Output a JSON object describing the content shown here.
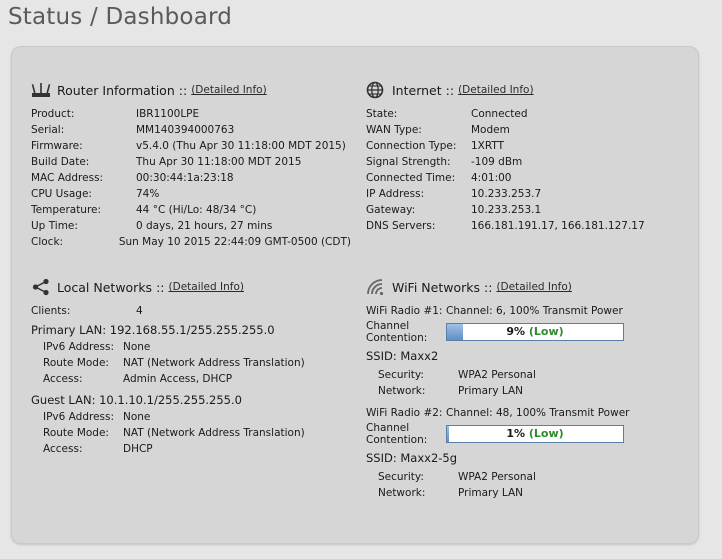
{
  "page": {
    "title": "Status / Dashboard"
  },
  "router": {
    "title": "Router Information",
    "sep": "::",
    "link": "(Detailed Info)",
    "rows": [
      {
        "k": "Product:",
        "v": "IBR1100LPE"
      },
      {
        "k": "Serial:",
        "v": "MM140394000763"
      },
      {
        "k": "Firmware:",
        "v": "v5.4.0 (Thu Apr 30 11:18:00 MDT 2015)"
      },
      {
        "k": "Build Date:",
        "v": "Thu Apr 30 11:18:00 MDT 2015"
      },
      {
        "k": "MAC Address:",
        "v": "00:30:44:1a:23:18"
      },
      {
        "k": "CPU Usage:",
        "v": "74%"
      },
      {
        "k": "Temperature:",
        "v": "44 °C (Hi/Lo: 48/34 °C)"
      },
      {
        "k": "Up Time:",
        "v": "0 days, 21 hours, 27 mins"
      },
      {
        "k": "Clock:",
        "v": "Sun May 10 2015 22:44:09 GMT-0500 (CDT)"
      }
    ]
  },
  "internet": {
    "title": "Internet",
    "sep": "::",
    "link": "(Detailed Info)",
    "rows": [
      {
        "k": "State:",
        "v": "Connected"
      },
      {
        "k": "WAN Type:",
        "v": "Modem"
      },
      {
        "k": "Connection Type:",
        "v": "1XRTT"
      },
      {
        "k": "Signal Strength:",
        "v": "-109 dBm"
      },
      {
        "k": "Connected Time:",
        "v": "4:01:00"
      },
      {
        "k": "IP Address:",
        "v": "10.233.253.7"
      },
      {
        "k": "Gateway:",
        "v": "10.233.253.1"
      },
      {
        "k": "DNS Servers:",
        "v": "166.181.191.17, 166.181.127.17"
      }
    ]
  },
  "local": {
    "title": "Local Networks",
    "sep": "::",
    "link": "(Detailed Info)",
    "clients_label": "Clients:",
    "clients_value": "4",
    "primary_lan": "Primary LAN: 192.168.55.1/255.255.255.0",
    "primary_rows": [
      {
        "k": "IPv6 Address:",
        "v": "None"
      },
      {
        "k": "Route Mode:",
        "v": "NAT (Network Address Translation)"
      },
      {
        "k": "Access:",
        "v": "Admin Access, DHCP"
      }
    ],
    "guest_lan": "Guest LAN: 10.1.10.1/255.255.255.0",
    "guest_rows": [
      {
        "k": "IPv6 Address:",
        "v": "None"
      },
      {
        "k": "Route Mode:",
        "v": "NAT (Network Address Translation)"
      },
      {
        "k": "Access:",
        "v": "DHCP"
      }
    ]
  },
  "wifi": {
    "title": "WiFi Networks",
    "sep": "::",
    "link": "(Detailed Info)",
    "channel_label": "Channel Contention:",
    "radios": [
      {
        "label": "WiFi Radio #1:",
        "value": "Channel: 6, 100% Transmit Power",
        "contention_pct": 9,
        "contention_text": "9%",
        "contention_level": "(Low)",
        "ssid": "SSID: Maxx2",
        "rows": [
          {
            "k": "Security:",
            "v": "WPA2 Personal"
          },
          {
            "k": "Network:",
            "v": "Primary LAN"
          }
        ]
      },
      {
        "label": "WiFi Radio #2:",
        "value": "Channel: 48, 100% Transmit Power",
        "contention_pct": 1,
        "contention_text": "1%",
        "contention_level": "(Low)",
        "ssid": "SSID: Maxx2-5g",
        "rows": [
          {
            "k": "Security:",
            "v": "WPA2 Personal"
          },
          {
            "k": "Network:",
            "v": "Primary LAN"
          }
        ]
      }
    ]
  },
  "colors": {
    "link": "#2b2b2b",
    "level_low": "#2e8b2e",
    "bar_border": "#5b7fa8",
    "bar_fill": "#6f9bcc"
  }
}
